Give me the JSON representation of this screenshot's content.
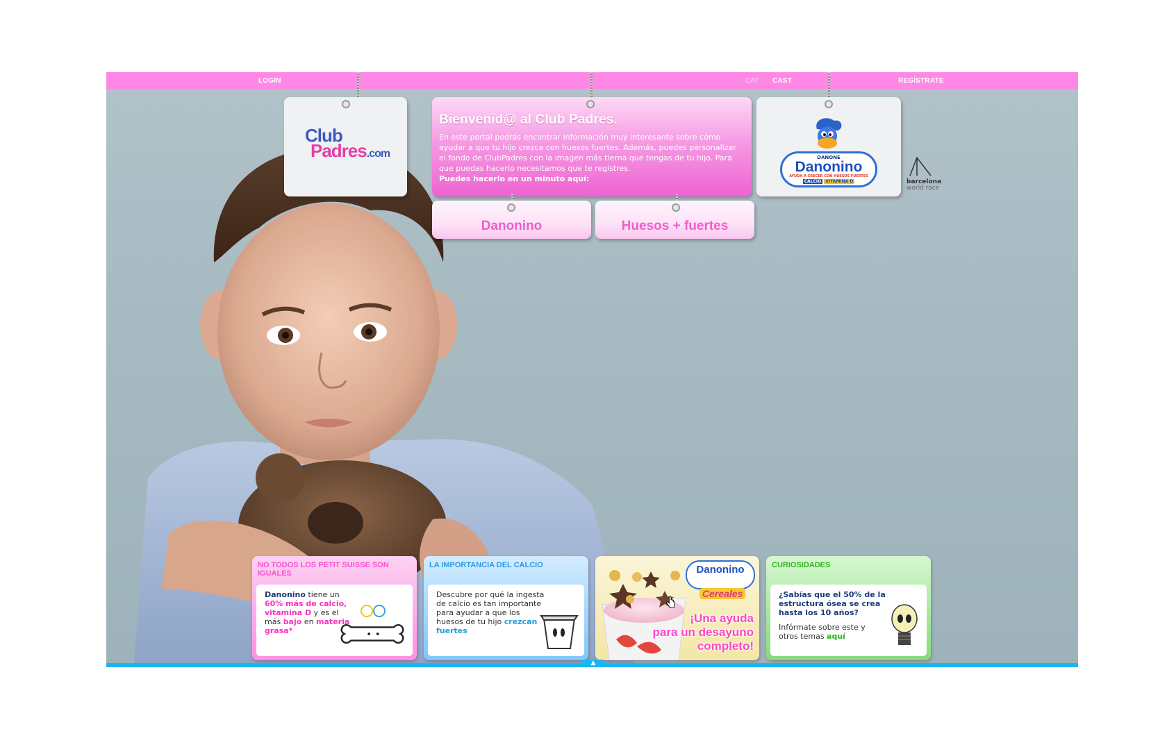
{
  "topbar": {
    "login": "LOGIN",
    "lang_cat": "CAT",
    "lang_cast": "CAST",
    "register": "REGÍSTRATE"
  },
  "logo_card": {
    "brand_line1": "Club",
    "brand_line2": "Padres",
    "brand_domain": ".com"
  },
  "welcome": {
    "title": "Bienvenid@ al Club Padres.",
    "body": "En este portal podrás encontrar información muy interesante sobre cómo ayudar a que tu hijo crezca con huesos fuertes. Además, puedes personalizar el fondo de ClubPadres con la imagen más tierna que tengas de tu hijo. Para que puedas hacerlo necesitamos que te registres.",
    "cta": "Puedes hacerlo en un minuto aquí:"
  },
  "danonino_logo_card": {
    "brand": "Danonino",
    "maker": "DANONE",
    "tagline": "AYUDA A CRECER CON HUESOS FUERTES",
    "calcio": "CALCIO",
    "vitamina": "VITAMINA D"
  },
  "nav_buttons": {
    "danonino": "Danonino",
    "huesos": "Huesos + fuertes"
  },
  "sponsor": {
    "line1": "barcelona",
    "line2": "world race"
  },
  "info_cards": {
    "petit_suisse": {
      "heading": "NO TODOS LOS PETIT SUISSE SON IGUALES",
      "t1": "Danonino",
      "t2": " tiene un ",
      "t3": "60% más de calcio, vitamina D",
      "t4": " y es el más ",
      "t5": "bajo",
      "t6": " en ",
      "t7": "materia grasa*"
    },
    "calcio": {
      "heading": "LA IMPORTANCIA DEL CALCIO",
      "t1": "Descubre por qué la ingesta de calcio es tan importante para ayudar a que los huesos de tu hijo ",
      "t2": "crezcan fuertes"
    },
    "promo": {
      "brand": "Danonino",
      "sub": "Cereales",
      "line1": "¡Una ayuda",
      "line2": "para un desayuno",
      "line3": "completo!"
    },
    "curiosidades": {
      "heading": "CURIOSIDADES",
      "q": "¿Sabías que el 50% de la estructura ósea se crea hasta los 10 años?",
      "t1": "Infórmate sobre este y otros temas ",
      "t2": "aquí"
    }
  },
  "colors": {
    "topbar": "#ff88e6",
    "pink": "#ee5fcb",
    "blue": "#16b8ef",
    "green": "#34b51f"
  }
}
